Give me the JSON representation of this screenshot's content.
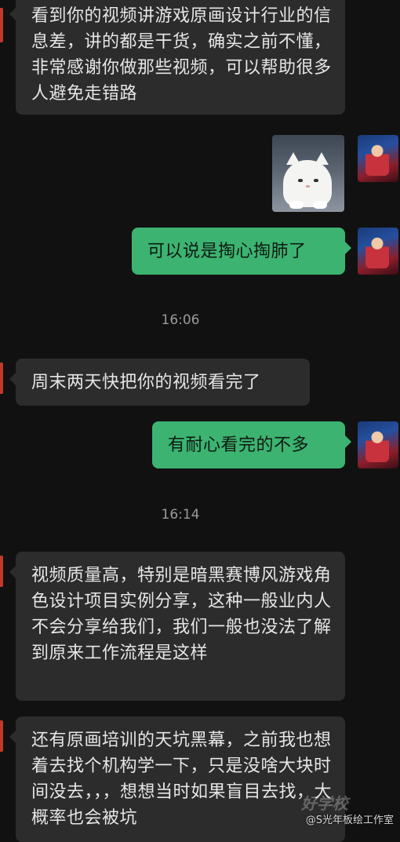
{
  "messages": [
    {
      "id": 1,
      "side": "in",
      "text": "看到你的视频讲游戏原画设计行业的信息差，讲的都是干货，确实之前不懂，非常感谢你做那些视频，可以帮助很多人避免走错路"
    },
    {
      "id": 2,
      "side": "out",
      "type": "sticker",
      "sticker": "white-cat-sticker"
    },
    {
      "id": 3,
      "side": "out",
      "text": "可以说是掏心掏肺了"
    },
    {
      "id": 4,
      "type": "time",
      "text": "16:06"
    },
    {
      "id": 5,
      "side": "in",
      "text": "周末两天快把你的视频看完了"
    },
    {
      "id": 6,
      "side": "out",
      "text": "有耐心看完的不多"
    },
    {
      "id": 7,
      "type": "time",
      "text": "16:14"
    },
    {
      "id": 8,
      "side": "in",
      "text": "视频质量高，特别是暗黑赛博风游戏角色设计项目实例分享，这种一般业内人不会分享给我们，我们一般也没法了解到原来工作流程是这样"
    },
    {
      "id": 9,
      "side": "in",
      "text": "还有原画培训的天坑黑幕，之前我也想着去找个机构学一下，只是没啥大块时间没去，，，想想当时如果盲目去找，大概率也会被坑"
    }
  ],
  "watermark": {
    "logo": "好学校",
    "text": "@S光年板绘工作室"
  },
  "colors": {
    "background": "#111111",
    "incoming": "#2c2c2c",
    "outgoing": "#3cb371",
    "edge": "#c0392b"
  }
}
